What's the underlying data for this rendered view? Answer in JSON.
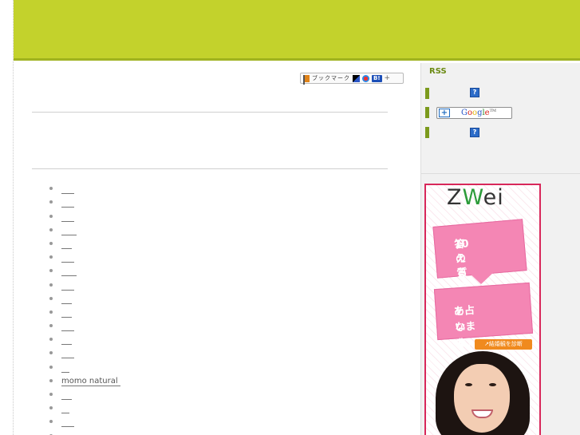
{
  "bookmark": {
    "label": "ブックマーク",
    "hatena_label": "B!",
    "plus_label": "+"
  },
  "sidebar": {
    "rss_title": "RSS",
    "question_icon_label": "?",
    "google_plus_label": "+",
    "google_logo": {
      "g": "G",
      "o1": "o",
      "o2": "o",
      "g2": "g",
      "l": "l",
      "e": "e",
      "tm": "TM"
    }
  },
  "list": {
    "items": [
      {
        "label": "     "
      },
      {
        "label": "     "
      },
      {
        "label": "     "
      },
      {
        "label": "      "
      },
      {
        "label": "    "
      },
      {
        "label": "     "
      },
      {
        "label": "      "
      },
      {
        "label": "     "
      },
      {
        "label": "    "
      },
      {
        "label": "    "
      },
      {
        "label": "     "
      },
      {
        "label": "    "
      },
      {
        "label": "     "
      },
      {
        "label": "   "
      },
      {
        "label": "momo natural "
      },
      {
        "label": "    "
      },
      {
        "label": "   "
      },
      {
        "label": "     "
      },
      {
        "label": ""
      }
    ]
  },
  "ad": {
    "logo_z": "Z",
    "logo_w": "W",
    "logo_rest": "ei",
    "line1": "10の質問に",
    "line2": "答えるだけ。",
    "line3": "あなたの結婚観",
    "line4": "を占います！",
    "cta": "↗結婚観を診断"
  },
  "colors": {
    "header_green": "#c3d22c",
    "rss_green": "#6b8a13",
    "ad_pink": "#f486b4",
    "ad_border": "#d8275a"
  }
}
